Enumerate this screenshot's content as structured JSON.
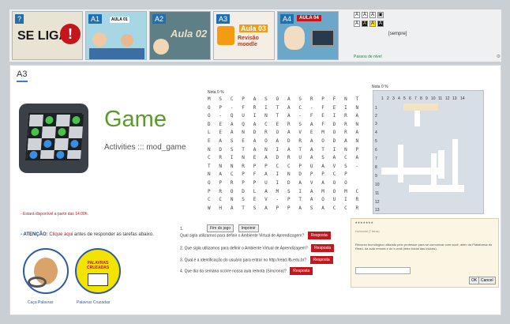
{
  "topbar": {
    "tiles": [
      {
        "badge": "?",
        "brand": "SE LIGA",
        "mark": "!"
      },
      {
        "badge": "A1",
        "title": "AULA 01"
      },
      {
        "badge": "A2",
        "title": "Aula 02"
      },
      {
        "badge": "A3",
        "title": "Aula 03",
        "subtitle": "Revisão moodle"
      },
      {
        "badge": "A4",
        "title": "AULA 04"
      }
    ],
    "tools": {
      "checkbox_label": "[sempre]",
      "link": "Passou de nível",
      "gear": "⚙"
    }
  },
  "section": {
    "title": "A3"
  },
  "game": {
    "title": "Game",
    "subtitle": "Activities ::: mod_game"
  },
  "notices": {
    "available": "- Estará disponível a partir das 14:00h.",
    "attention_label": "- ATENÇÃO:",
    "attention_link": "Clique aqui",
    "attention_rest": "antes de responder as tarefas abaixo."
  },
  "links": [
    {
      "label": "Caça Palavras"
    },
    {
      "label": "Palavras Cruzadas",
      "badge": "PALAVRAS CRUZADAS"
    }
  ],
  "wordsearch": {
    "grade": "Nota 0 %",
    "rows": [
      "M S C P A S O A S R P F N T",
      "O P - F R I T A C - F E I N",
      "O - Q U I N T A - F E I R A",
      "D E A Q A C E R S A F D R N",
      "L E A N D R O A V E M O R A",
      "E A S E A O A D R A O D A N",
      "N D S T A N I A T A T I N P",
      "C R I N E A D R U A S A C A",
      "T N N R P P C C P U A V S -",
      "N A C P F A I N D P P C P",
      "O P R P P U I D A V A O O",
      "P R O D L A M S I A M O M C",
      "C C N S E V - P T A O U I R",
      "W H A T S A P P A S A C C R"
    ],
    "buttons": [
      "Fim do jogo",
      "Imprimir"
    ],
    "questions": [
      {
        "num": "1.",
        "text": "Qual sigla utilizamos para definir o Ambiente Virtual de Aprendizagem?",
        "button": "Resposta"
      },
      {
        "num": "2.",
        "text": "Que sigla utilizamos para definir o Ambiente Virtual de Aprendizagem?",
        "button": "Resposta"
      },
      {
        "num": "3.",
        "text": "Qual é a identificação do usuário para entrar no http://read.ifb.edu.br?",
        "button": "Resposta"
      },
      {
        "num": "4.",
        "text": "Que dia da semana ocorre nossa aula remota (Síncrona)?",
        "button": "Resposta"
      }
    ]
  },
  "crossword": {
    "grade": "Nota 0 %",
    "cols": [
      "1",
      "2",
      "3",
      "4",
      "5",
      "6",
      "7",
      "8",
      "9",
      "10",
      "11",
      "12",
      "13",
      "14"
    ],
    "rows": [
      "1",
      "2",
      "3",
      "4",
      "5",
      "6",
      "7",
      "8",
      "9",
      "10",
      "11",
      "12",
      "13"
    ]
  },
  "dialog": {
    "title": "*******",
    "subtitle": "Horizontal (7 letras)",
    "text": "Recurso tecnológico utilizado pelo professor para se comunicar com você, além da Plataforma do Read, da aula remota e do e-mail (letra inicial das iniciais).",
    "ok": "OK",
    "cancel": "Cancel"
  },
  "colors": {
    "accent": "#5a9a2a",
    "danger": "#c4161c",
    "link": "#2b5aa0"
  }
}
